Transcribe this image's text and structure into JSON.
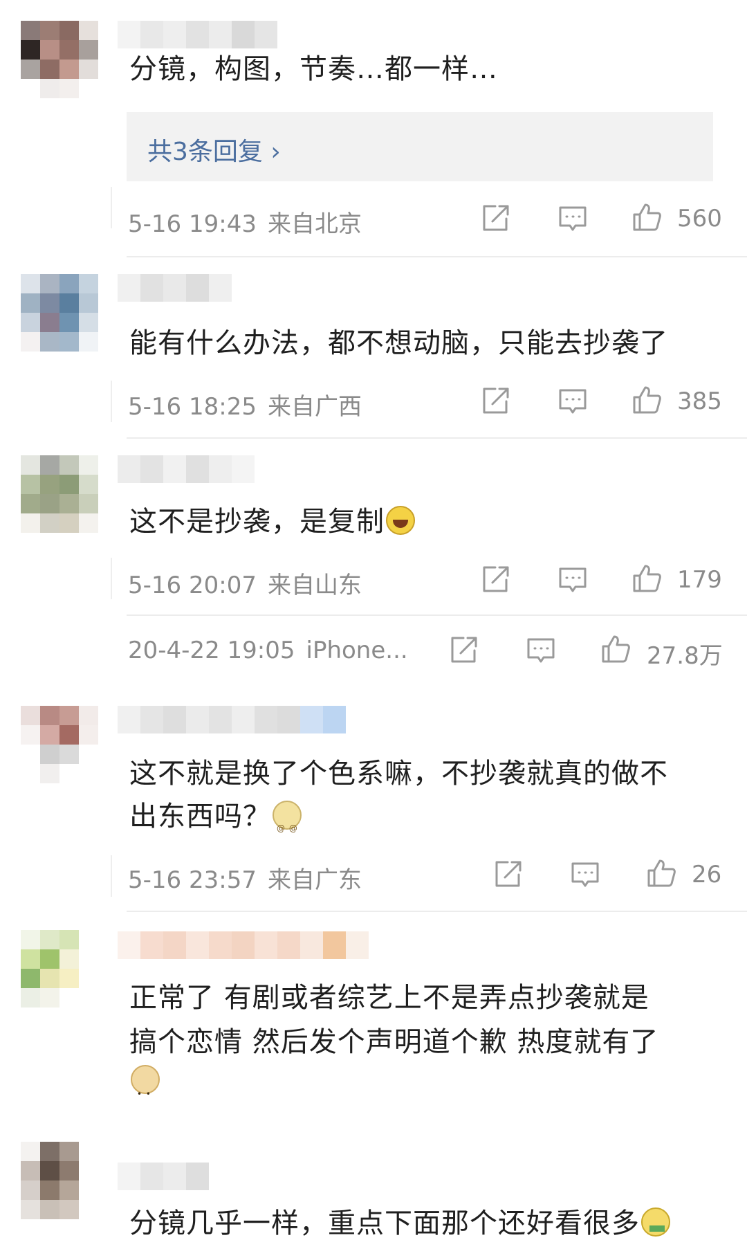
{
  "colors": {
    "reply_link": "#4b6e9f",
    "meta_text": "#8a8a8a",
    "reply_bg": "#f2f2f2"
  },
  "icons": [
    "share-icon",
    "comment-icon",
    "like-icon"
  ],
  "comments": [
    {
      "text": "分镜，构图，节奏…都一样…",
      "replies": "共3条回复 ›",
      "time": "5-16 19:43",
      "location": "来自北京",
      "likes": "560"
    },
    {
      "text": "能有什么办法，都不想动脑，只能去抄袭了",
      "time": "5-16 18:25",
      "location": "来自广西",
      "likes": "385"
    },
    {
      "text": "这不是抄袭，是复制",
      "time": "5-16 20:07",
      "location": "来自山东",
      "likes": "179"
    },
    {
      "time": "20-4-22 19:05",
      "location": "iPhone...",
      "likes": "27.8万"
    },
    {
      "text_line1": "这不就是换了个色系嘛，不抄袭就真的做不",
      "text_line2": "出东西吗？",
      "time": "5-16 23:57",
      "location": "来自广东",
      "likes": "26"
    },
    {
      "text_line1": "正常了 有剧或者综艺上不是弄点抄袭就是",
      "text_line2": "搞个恋情 然后发个声明道个歉 热度就有了"
    },
    {
      "text": "分镜几乎一样，重点下面那个还好看很多"
    }
  ]
}
